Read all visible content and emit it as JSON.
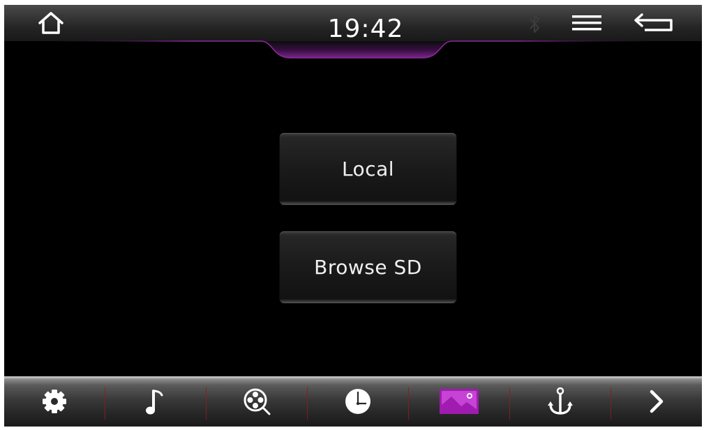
{
  "status_bar": {
    "time": "19:42",
    "icons": [
      "home-icon",
      "bluetooth-icon",
      "menu-icon",
      "back-icon"
    ]
  },
  "main": {
    "local_label": "Local",
    "browse_sd_label": "Browse SD"
  },
  "dock": {
    "items": [
      "settings-icon",
      "music-icon",
      "video-icon",
      "clock-icon",
      "gallery-icon",
      "navigation-icon",
      "next-icon"
    ],
    "active_item": "gallery-icon",
    "accent_color": "#a01bb0",
    "separator_color": "#8a1e1e"
  },
  "colors": {
    "background": "#000000",
    "accent_glow": "#6a1a74"
  }
}
